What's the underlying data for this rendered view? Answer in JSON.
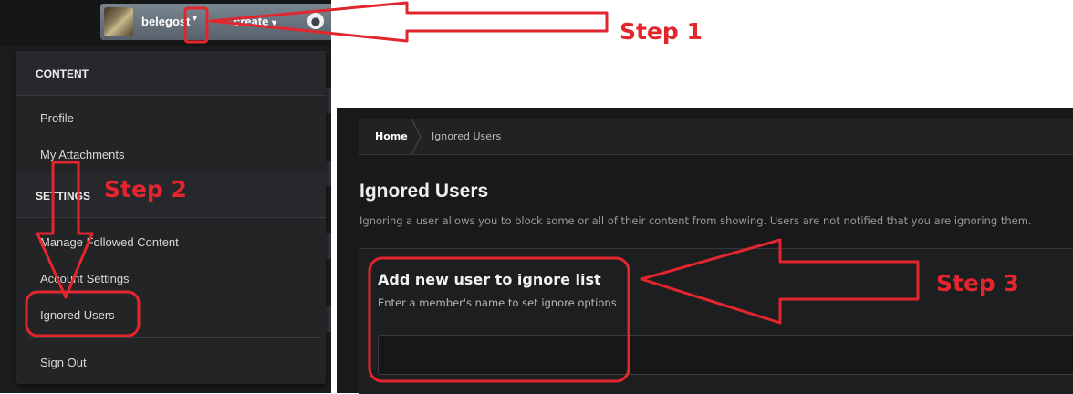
{
  "header": {
    "username": "belegost",
    "create_label": "create",
    "user_caret": "▾",
    "create_caret": "▾"
  },
  "menu": {
    "sections": [
      {
        "heading": "CONTENT",
        "items": [
          "Profile",
          "My Attachments"
        ]
      },
      {
        "heading": "SETTINGS",
        "items": [
          "Manage Followed Content",
          "Account Settings",
          "Ignored Users"
        ]
      }
    ],
    "sign_out": "Sign Out"
  },
  "breadcrumb": {
    "home": "Home",
    "current": "Ignored Users"
  },
  "page": {
    "title": "Ignored Users",
    "description": "Ignoring a user allows you to block some or all of their content from showing. Users are not notified that you are ignoring them.",
    "add_title": "Add new user to ignore list",
    "add_subtitle": "Enter a member's name to set ignore options",
    "input_value": ""
  },
  "annotations": {
    "step1": "Step 1",
    "step2": "Step 2",
    "step3": "Step 3",
    "color": "#e3262e"
  },
  "colors": {
    "panel_bg": "#19191b",
    "menu_bg": "#232426",
    "userbar": "#6b7680"
  },
  "icons": {
    "globe": "globe-icon",
    "avatar": "avatar"
  }
}
